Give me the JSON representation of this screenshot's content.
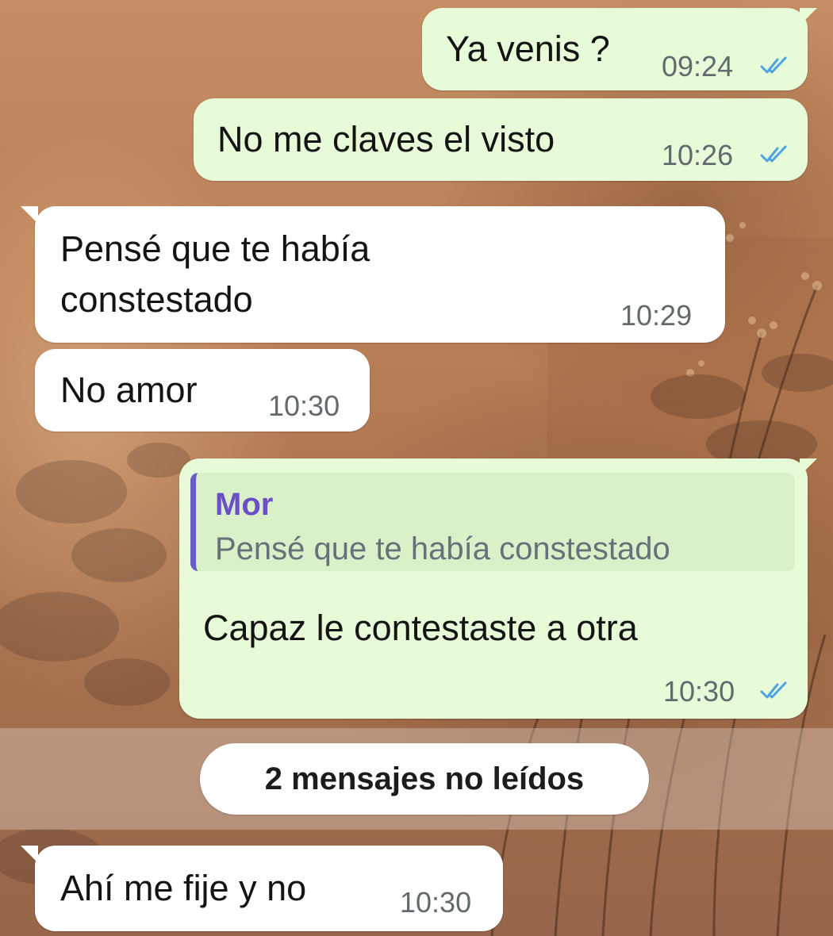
{
  "colors": {
    "outgoing_bubble": "#e7fbd9",
    "incoming_bubble": "#ffffff",
    "read_ticks": "#4fa3e0",
    "quote_bar": "#6a5acd",
    "quote_author": "#6a4fc6"
  },
  "messages": [
    {
      "direction": "outgoing",
      "text": "Ya venis ?",
      "time": "09:24",
      "status": "read",
      "status_icon": "double-check-icon"
    },
    {
      "direction": "outgoing",
      "text": "No me claves el visto",
      "time": "10:26",
      "status": "read",
      "status_icon": "double-check-icon"
    },
    {
      "direction": "incoming",
      "text_line1": "Pensé que te había",
      "text_line2": "constestado",
      "time": "10:29"
    },
    {
      "direction": "incoming",
      "text": "No amor",
      "time": "10:30"
    },
    {
      "direction": "outgoing",
      "reply": {
        "author": "Mor",
        "text": "Pensé que te había constestado"
      },
      "text": "Capaz le contestaste a otra",
      "time": "10:30",
      "status": "read",
      "status_icon": "double-check-icon"
    },
    {
      "direction": "incoming",
      "text": "Ahí me fije y no",
      "time": "10:30"
    }
  ],
  "unread_divider": {
    "label": "2 mensajes no leídos"
  }
}
